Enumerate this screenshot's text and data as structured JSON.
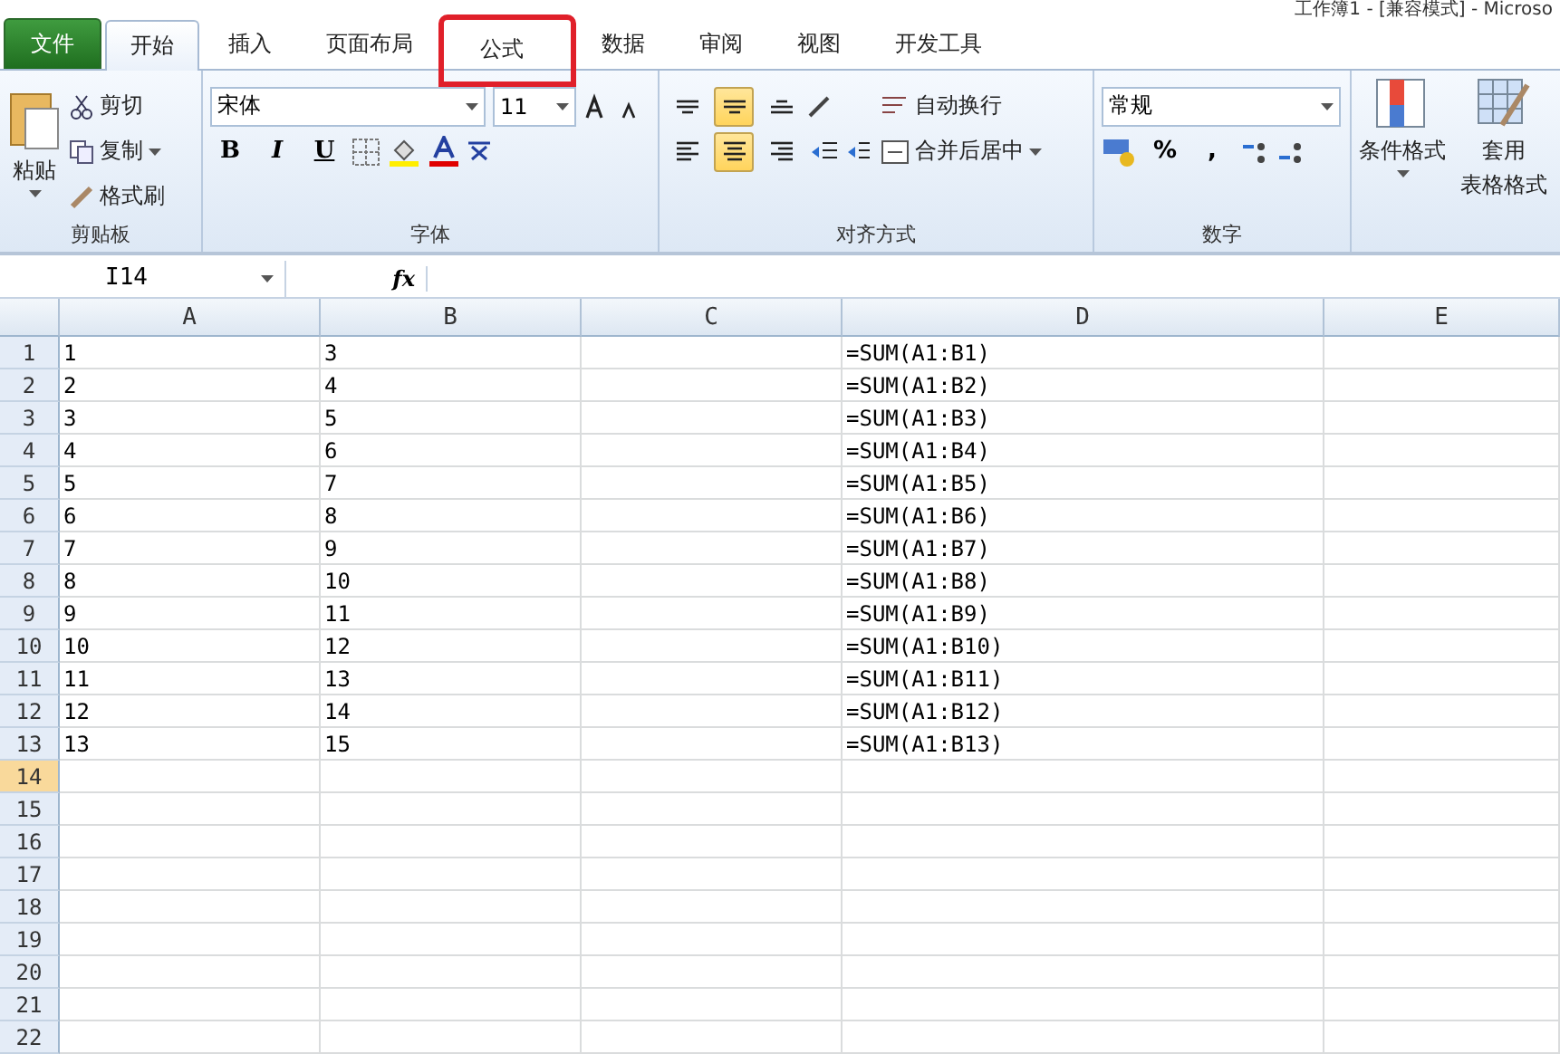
{
  "window": {
    "title": "工作簿1 - [兼容模式] - Microso"
  },
  "tabs": [
    {
      "label": "文件",
      "kind": "file",
      "selected": false,
      "highlighted": false
    },
    {
      "label": "开始",
      "kind": "tab",
      "selected": true,
      "highlighted": false
    },
    {
      "label": "插入",
      "kind": "tab",
      "selected": false,
      "highlighted": false
    },
    {
      "label": "页面布局",
      "kind": "tab",
      "selected": false,
      "highlighted": false
    },
    {
      "label": "公式",
      "kind": "tab",
      "selected": false,
      "highlighted": true
    },
    {
      "label": "数据",
      "kind": "tab",
      "selected": false,
      "highlighted": false
    },
    {
      "label": "审阅",
      "kind": "tab",
      "selected": false,
      "highlighted": false
    },
    {
      "label": "视图",
      "kind": "tab",
      "selected": false,
      "highlighted": false
    },
    {
      "label": "开发工具",
      "kind": "tab",
      "selected": false,
      "highlighted": false
    }
  ],
  "clipboard": {
    "group": "剪贴板",
    "paste": "粘贴",
    "cut": "剪切",
    "copy": "复制",
    "format_painter": "格式刷"
  },
  "font": {
    "group": "字体",
    "name": "宋体",
    "size": "11",
    "bold": "B",
    "italic": "I",
    "underline": "U"
  },
  "alignment": {
    "group": "对齐方式",
    "vertical": [
      {
        "kind": "top",
        "selected": false
      },
      {
        "kind": "middle",
        "selected": true
      },
      {
        "kind": "bottom",
        "selected": false
      }
    ],
    "horizontal": [
      {
        "kind": "left",
        "selected": false
      },
      {
        "kind": "center",
        "selected": true
      },
      {
        "kind": "right",
        "selected": false
      }
    ],
    "wrap": "自动换行",
    "merge": "合并后居中"
  },
  "number": {
    "group": "数字",
    "format": "常规",
    "percent": "%",
    "comma": ","
  },
  "styles": {
    "conditional": "条件格式",
    "table_format": [
      "套用",
      "表格格式"
    ]
  },
  "formula_bar": {
    "name_box": "I14",
    "fx": "fx"
  },
  "sheet": {
    "columns": [
      "A",
      "B",
      "C",
      "D",
      "E"
    ],
    "rows": [
      [
        "1",
        "3",
        "",
        "=SUM(A1:B1)",
        ""
      ],
      [
        "2",
        "4",
        "",
        "=SUM(A1:B2)",
        ""
      ],
      [
        "3",
        "5",
        "",
        "=SUM(A1:B3)",
        ""
      ],
      [
        "4",
        "6",
        "",
        "=SUM(A1:B4)",
        ""
      ],
      [
        "5",
        "7",
        "",
        "=SUM(A1:B5)",
        ""
      ],
      [
        "6",
        "8",
        "",
        "=SUM(A1:B6)",
        ""
      ],
      [
        "7",
        "9",
        "",
        "=SUM(A1:B7)",
        ""
      ],
      [
        "8",
        "10",
        "",
        "=SUM(A1:B8)",
        ""
      ],
      [
        "9",
        "11",
        "",
        "=SUM(A1:B9)",
        ""
      ],
      [
        "10",
        "12",
        "",
        "=SUM(A1:B10)",
        ""
      ],
      [
        "11",
        "13",
        "",
        "=SUM(A1:B11)",
        ""
      ],
      [
        "12",
        "14",
        "",
        "=SUM(A1:B12)",
        ""
      ],
      [
        "13",
        "15",
        "",
        "=SUM(A1:B13)",
        ""
      ]
    ],
    "row_headers": [
      {
        "label": "1",
        "selected": false
      },
      {
        "label": "2",
        "selected": false
      },
      {
        "label": "3",
        "selected": false
      },
      {
        "label": "4",
        "selected": false
      },
      {
        "label": "5",
        "selected": false
      },
      {
        "label": "6",
        "selected": false
      },
      {
        "label": "7",
        "selected": false
      },
      {
        "label": "8",
        "selected": false
      },
      {
        "label": "9",
        "selected": false
      },
      {
        "label": "10",
        "selected": false
      },
      {
        "label": "11",
        "selected": false
      },
      {
        "label": "12",
        "selected": false
      },
      {
        "label": "13",
        "selected": false
      },
      {
        "label": "14",
        "selected": true
      },
      {
        "label": "15",
        "selected": false
      },
      {
        "label": "16",
        "selected": false
      },
      {
        "label": "17",
        "selected": false
      },
      {
        "label": "18",
        "selected": false
      },
      {
        "label": "19",
        "selected": false
      },
      {
        "label": "20",
        "selected": false
      },
      {
        "label": "21",
        "selected": false
      },
      {
        "label": "22",
        "selected": false
      }
    ]
  }
}
